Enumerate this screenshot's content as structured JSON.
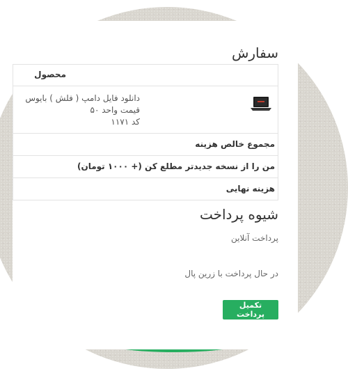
{
  "order": {
    "title": "سفارش",
    "header_cell": "محصول",
    "product": {
      "thumb_icon": "laptop-icon",
      "name": "دانلود فایل دامپ ( فلش ) بایوس",
      "unit_price": "قیمت واحد ۵۰",
      "code": "کد ۱۱۷۱"
    },
    "rows": [
      {
        "label": "مجموع خالص هزینه"
      },
      {
        "label": "من را از نسخه جدیدتر مطلع کن (+ ۱۰۰۰ تومان)"
      },
      {
        "label": "هزینه نهایی"
      }
    ]
  },
  "payment": {
    "title": "شیوه پرداخت",
    "method": "پرداخت آنلاین",
    "status": "در حال پرداخت با زرین پال",
    "submit_label": "تکمیل پرداخت"
  },
  "colors": {
    "accent": "#27ae60",
    "background_circle": "#d9d6cf"
  }
}
